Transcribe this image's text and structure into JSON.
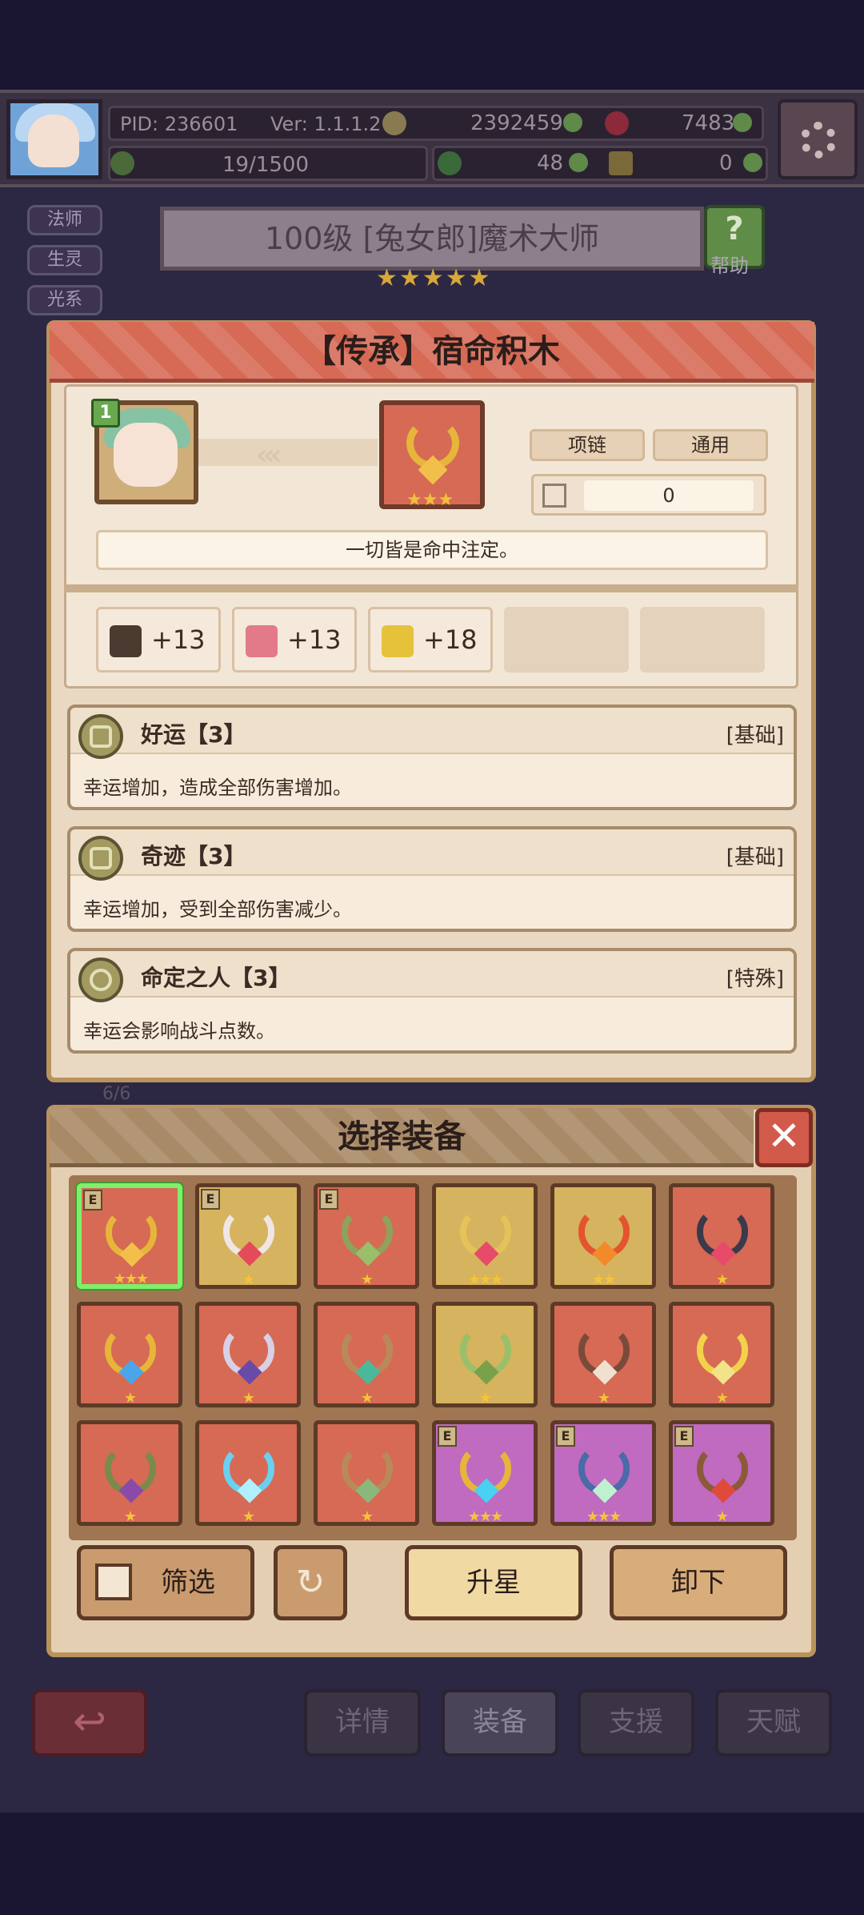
{
  "top_status": {
    "pid": "PID: 236601",
    "version": "Ver: 1.1.1.2",
    "gold": "2392459",
    "gems": "7483",
    "exp_progress": "19/1500",
    "clover_count": "48",
    "key_count": "0"
  },
  "side_tags": [
    "法师",
    "生灵",
    "光系"
  ],
  "hero": {
    "title": "100级 [兔女郎]魔术大师",
    "stars": "★★★★★",
    "help_label": "帮助"
  },
  "detail_panel": {
    "title": "【传承】宿命积木",
    "char_level": "1",
    "item_stars": "★★★",
    "type_label": "项链",
    "scope_label": "通用",
    "count_value": "0",
    "quote": "一切皆是命中注定。",
    "stats": [
      {
        "icon": "book-icon",
        "value": "+13"
      },
      {
        "icon": "heart-icon",
        "value": "+13"
      },
      {
        "icon": "clover-icon",
        "value": "+18"
      }
    ],
    "skills": [
      {
        "name": "好运【3】",
        "tag": "[基础]",
        "desc": "幸运增加，造成全部伤害增加。"
      },
      {
        "name": "奇迹【3】",
        "tag": "[基础]",
        "desc": "幸运增加，受到全部伤害减少。"
      },
      {
        "name": "命定之人【3】",
        "tag": "[特殊]",
        "desc": "幸运会影响战斗点数。"
      }
    ],
    "hidden_count": "6/6"
  },
  "equip_panel": {
    "title": "选择装备",
    "close_label": "✕",
    "items": [
      {
        "bg": "#d66a55",
        "chain": "#e6b53a",
        "gem": "#f2c04a",
        "stars": "★★★",
        "e": "E",
        "selected": true
      },
      {
        "bg": "#d6b35e",
        "chain": "#f0e6e6",
        "gem": "#e44a5a",
        "stars": "★",
        "e": "E",
        "selected": false
      },
      {
        "bg": "#d66a55",
        "chain": "#8ea25a",
        "gem": "#9abf6a",
        "stars": "★",
        "e": "E",
        "selected": false
      },
      {
        "bg": "#d6b35e",
        "chain": "#e6c25a",
        "gem": "#e84a6a",
        "stars": "★★★",
        "e": "",
        "selected": false
      },
      {
        "bg": "#d6b35e",
        "chain": "#e4542e",
        "gem": "#f28a2a",
        "stars": "★★",
        "e": "",
        "selected": false
      },
      {
        "bg": "#d66a55",
        "chain": "#3a3a4a",
        "gem": "#e84a6a",
        "stars": "★",
        "e": "",
        "selected": false
      },
      {
        "bg": "#d66a55",
        "chain": "#e6b53a",
        "gem": "#4aa6e8",
        "stars": "★",
        "e": "",
        "selected": false
      },
      {
        "bg": "#d66a55",
        "chain": "#d8d0e6",
        "gem": "#6a4aa8",
        "stars": "★",
        "e": "",
        "selected": false
      },
      {
        "bg": "#d66a55",
        "chain": "#b88a5a",
        "gem": "#4ab89a",
        "stars": "★",
        "e": "",
        "selected": false
      },
      {
        "bg": "#d6b35e",
        "chain": "#9abf6a",
        "gem": "#7aa04a",
        "stars": "★",
        "e": "",
        "selected": false
      },
      {
        "bg": "#d66a55",
        "chain": "#7a4a3a",
        "gem": "#f0e0d0",
        "stars": "★",
        "e": "",
        "selected": false
      },
      {
        "bg": "#d66a55",
        "chain": "#f2d24a",
        "gem": "#f2e28a",
        "stars": "★",
        "e": "",
        "selected": false
      },
      {
        "bg": "#d66a55",
        "chain": "#7a8a4a",
        "gem": "#8a4aa8",
        "stars": "★",
        "e": "",
        "selected": false
      },
      {
        "bg": "#d66a55",
        "chain": "#6ad0f0",
        "gem": "#aef0ff",
        "stars": "★",
        "e": "",
        "selected": false
      },
      {
        "bg": "#d66a55",
        "chain": "#b88a5a",
        "gem": "#8ab87a",
        "stars": "★",
        "e": "",
        "selected": false
      },
      {
        "bg": "#c06ac0",
        "chain": "#e6b53a",
        "gem": "#4ad0f0",
        "stars": "★★★",
        "e": "E",
        "selected": false
      },
      {
        "bg": "#c06ac0",
        "chain": "#4a6aa8",
        "gem": "#bff0d0",
        "stars": "★★★",
        "e": "E",
        "selected": false
      },
      {
        "bg": "#c06ac0",
        "chain": "#8a5a3a",
        "gem": "#e04a3a",
        "stars": "★",
        "e": "E",
        "selected": false
      }
    ],
    "buttons": {
      "filter": "筛选",
      "upgrade": "升星",
      "unequip": "卸下"
    }
  },
  "bottom_nav": {
    "tabs": [
      "详情",
      "装备",
      "支援",
      "天赋"
    ],
    "active": "装备"
  }
}
